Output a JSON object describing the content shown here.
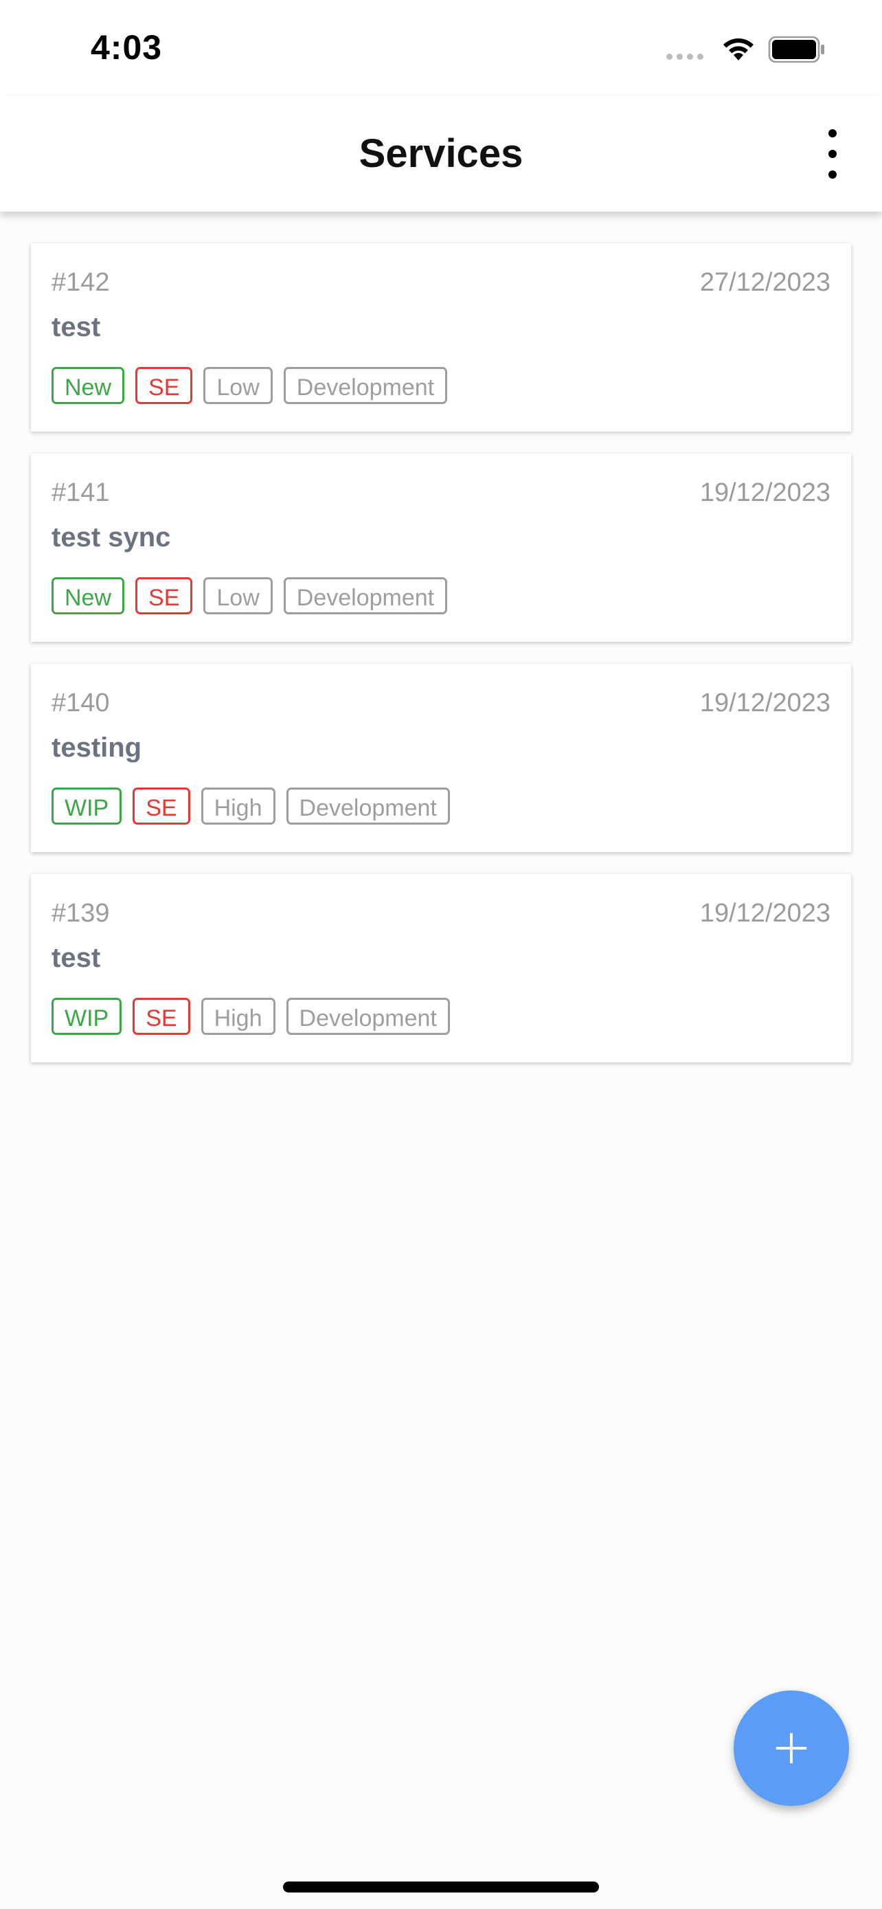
{
  "status_bar": {
    "time": "4:03",
    "icons": [
      "cellular-signal-icon",
      "wifi-icon",
      "battery-icon"
    ]
  },
  "header": {
    "title": "Services",
    "menu_icon": "more-vertical-icon"
  },
  "services": [
    {
      "id": "#142",
      "date": "27/12/2023",
      "title": "test",
      "status": "New",
      "type": "SE",
      "priority": "Low",
      "category": "Development"
    },
    {
      "id": "#141",
      "date": "19/12/2023",
      "title": "test sync",
      "status": "New",
      "type": "SE",
      "priority": "Low",
      "category": "Development"
    },
    {
      "id": "#140",
      "date": "19/12/2023",
      "title": "testing",
      "status": "WIP",
      "type": "SE",
      "priority": "High",
      "category": "Development"
    },
    {
      "id": "#139",
      "date": "19/12/2023",
      "title": "test",
      "status": "WIP",
      "type": "SE",
      "priority": "High",
      "category": "Development"
    }
  ],
  "fab": {
    "icon": "plus-icon"
  },
  "colors": {
    "status_tag": "#3aa845",
    "type_tag": "#e53935",
    "neutral_tag": "#9e9e9e",
    "fab": "#5a9cf6"
  }
}
